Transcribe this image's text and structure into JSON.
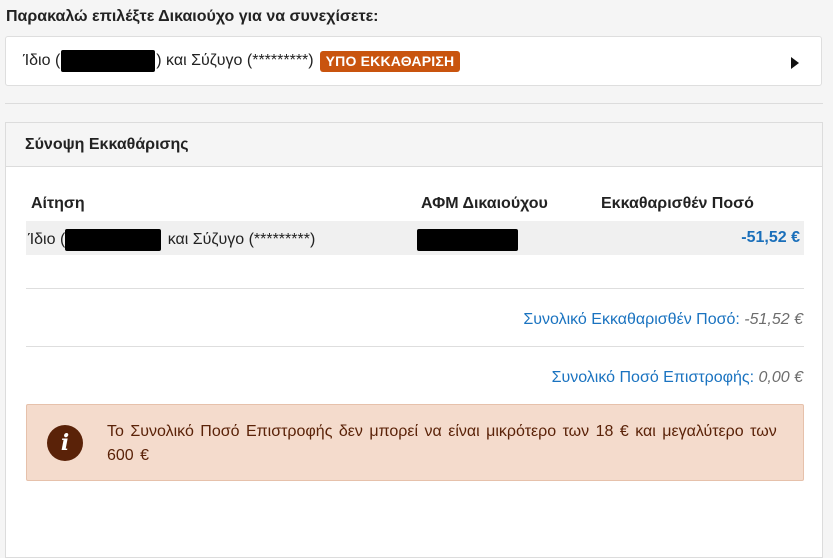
{
  "prompt": "Παρακαλώ επιλέξτε Δικαιούχο για να συνεχίσετε:",
  "selector": {
    "prefix": "Ίδιο (",
    "suffix": ") και Σύζυγο (*********)",
    "badge": "ΥΠΟ ΕΚΚΑΘΑΡΙΣΗ"
  },
  "summary": {
    "title": "Σύνοψη Εκκαθάρισης",
    "headers": [
      "Αίτηση",
      "ΑΦΜ Δικαιούχου",
      "Εκκαθαρισθέν Ποσό"
    ],
    "row": {
      "prefix": "Ίδιο (",
      "suffix": " και Σύζυγο (*********)",
      "amount": "-51,52 €"
    },
    "total_label": "Συνολικό Εκκαθαρισθέν Ποσό:",
    "total_value": "-51,52 €",
    "refund_label": "Συνολικό Ποσό Επιστροφής:",
    "refund_value": "0,00 €"
  },
  "alert": {
    "icon": "info-icon",
    "text": "Το Συνολικό Ποσό Επιστροφής δεν μπορεί να είναι μικρότερο των 18 € και μεγαλύτερο των 600 €"
  },
  "colors": {
    "badge": "#c9540e",
    "link": "#1a73c0",
    "alert_bg": "#f4dbcc",
    "alert_text": "#5a2208"
  }
}
